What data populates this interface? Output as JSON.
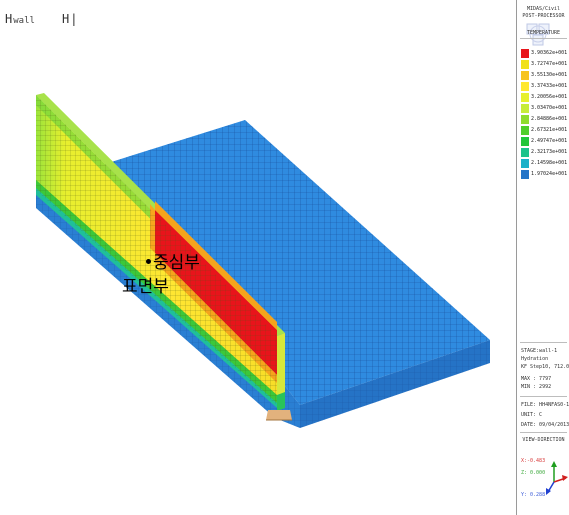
{
  "toolbar": {
    "icon1": "H",
    "label1": "wall",
    "icon2": "H"
  },
  "annotations": {
    "center": "중심부",
    "surface": "표면부"
  },
  "panel": {
    "header_lines": [
      "MIDAS/Civil",
      "POST-PROCESSOR"
    ],
    "result_type": "TEMPERATURE",
    "legend": [
      {
        "value": "3.90362e+001",
        "color": "#e8141b"
      },
      {
        "value": "3.72747e+001",
        "color": "#f0e11a"
      },
      {
        "value": "3.55130e+001",
        "color": "#f7c41e"
      },
      {
        "value": "3.37433e+001",
        "color": "#ffe832"
      },
      {
        "value": "3.20056e+001",
        "color": "#e7f02f"
      },
      {
        "value": "3.03470e+001",
        "color": "#c7ec3a"
      },
      {
        "value": "2.84886e+001",
        "color": "#8fdc2e"
      },
      {
        "value": "2.67321e+001",
        "color": "#4fce2a"
      },
      {
        "value": "2.49747e+001",
        "color": "#20c63a"
      },
      {
        "value": "2.32173e+001",
        "color": "#1dc38c"
      },
      {
        "value": "2.14598e+001",
        "color": "#1bb1c9"
      },
      {
        "value": "1.97024e+001",
        "color": "#2374c8"
      }
    ],
    "info_lines": [
      "STAGE:wall-1",
      "Hydration",
      "KF Step10, 712.0-",
      "MAX : 7797",
      "MIN : 2992"
    ],
    "file_lines": [
      "FILE: HH4NFAS0-1",
      "UNIT: C",
      "DATE: 09/04/2013"
    ],
    "view_direction": "VIEW-DIRECTION",
    "axis_labels": {
      "x": "X:-0.483",
      "z": "Z: 0.000",
      "y": "Y: 0.288"
    }
  }
}
